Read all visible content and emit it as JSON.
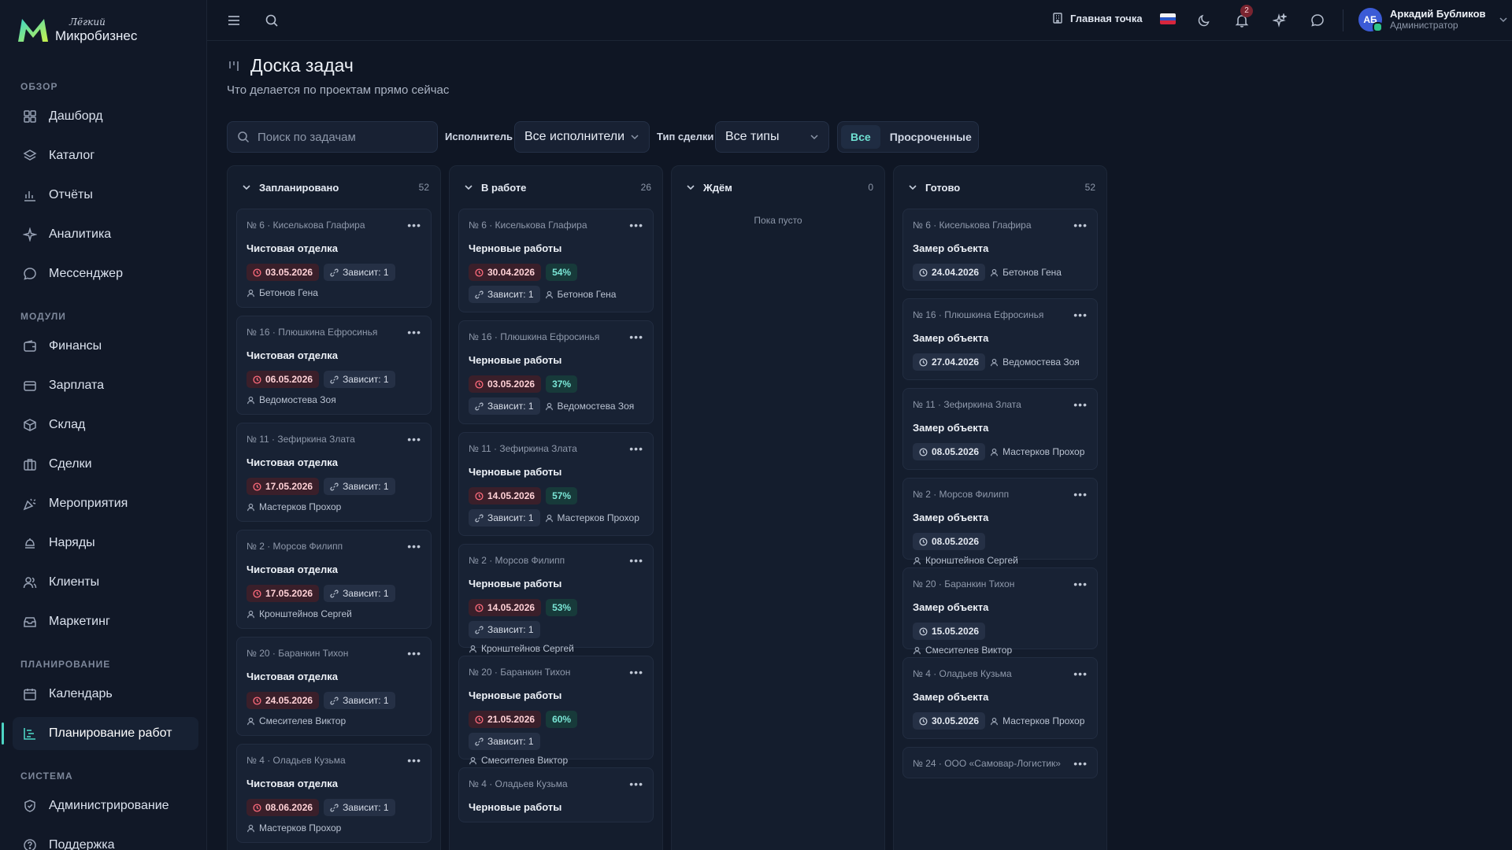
{
  "brand": {
    "small": "Лёгкий",
    "big": "Микробизнес"
  },
  "sidebar": {
    "sections": [
      {
        "label": "ОБЗОР",
        "items": [
          {
            "label": "Дашборд",
            "icon": "dashboard-icon"
          },
          {
            "label": "Каталог",
            "icon": "catalog-icon"
          },
          {
            "label": "Отчёты",
            "icon": "reports-icon"
          },
          {
            "label": "Аналитика",
            "icon": "analytics-icon"
          },
          {
            "label": "Мессенджер",
            "icon": "messenger-icon"
          }
        ]
      },
      {
        "label": "МОДУЛИ",
        "items": [
          {
            "label": "Финансы",
            "icon": "wallet-icon"
          },
          {
            "label": "Зарплата",
            "icon": "salary-icon"
          },
          {
            "label": "Склад",
            "icon": "warehouse-icon"
          },
          {
            "label": "Сделки",
            "icon": "deals-icon"
          },
          {
            "label": "Мероприятия",
            "icon": "party-icon"
          },
          {
            "label": "Наряды",
            "icon": "orders-icon"
          },
          {
            "label": "Клиенты",
            "icon": "clients-icon"
          },
          {
            "label": "Маркетинг",
            "icon": "marketing-icon"
          }
        ]
      },
      {
        "label": "ПЛАНИРОВАНИЕ",
        "items": [
          {
            "label": "Календарь",
            "icon": "calendar-icon"
          },
          {
            "label": "Планирование работ",
            "icon": "planning-icon",
            "active": true
          }
        ]
      },
      {
        "label": "СИСТЕМА",
        "items": [
          {
            "label": "Администрирование",
            "icon": "shield-icon"
          },
          {
            "label": "Поддержка",
            "icon": "help-icon"
          }
        ]
      }
    ]
  },
  "topbar": {
    "point_label": "Главная точка",
    "notifications_count": "2",
    "user": {
      "initials": "АБ",
      "name": "Аркадий Бубликов",
      "role": "Администратор"
    }
  },
  "page": {
    "title": "Доска задач",
    "subtitle": "Что делается по проектам прямо сейчас"
  },
  "filters": {
    "search_placeholder": "Поиск по задачам",
    "executor_label": "Исполнитель",
    "executor_value": "Все исполнители",
    "deal_type_label": "Тип сделки",
    "deal_type_value": "Все типы",
    "toggle": [
      "Все",
      "Просроченные"
    ]
  },
  "colors": {
    "accent": "#4dd4c4",
    "overdue": "#ff6b7c",
    "background": "#0f1624"
  },
  "columns": [
    {
      "title": "Запланировано",
      "count": "52",
      "empty_text": "",
      "cards": [
        {
          "meta": "№ 6 · Киселькова Глафира",
          "title": "Чистовая отделка",
          "date": "03.05.2026",
          "overdue": true,
          "pct": "",
          "dep": "Зависит: 1",
          "person": "Бетонов Гена"
        },
        {
          "meta": "№ 16 · Плюшкина Ефросинья",
          "title": "Чистовая отделка",
          "date": "06.05.2026",
          "overdue": true,
          "pct": "",
          "dep": "Зависит: 1",
          "person": "Ведомостева Зоя"
        },
        {
          "meta": "№ 11 · Зефиркина Злата",
          "title": "Чистовая отделка",
          "date": "17.05.2026",
          "overdue": true,
          "pct": "",
          "dep": "Зависит: 1",
          "person": "Мастерков Прохор"
        },
        {
          "meta": "№ 2 · Морсов Филипп",
          "title": "Чистовая отделка",
          "date": "17.05.2026",
          "overdue": true,
          "pct": "",
          "dep": "Зависит: 1",
          "person": "Кронштейнов Сергей"
        },
        {
          "meta": "№ 20 · Баранкин Тихон",
          "title": "Чистовая отделка",
          "date": "24.05.2026",
          "overdue": true,
          "pct": "",
          "dep": "Зависит: 1",
          "person": "Смесителев Виктор"
        },
        {
          "meta": "№ 4 · Оладьев Кузьма",
          "title": "Чистовая отделка",
          "date": "08.06.2026",
          "overdue": true,
          "pct": "",
          "dep": "Зависит: 1",
          "person": "Мастерков Прохор"
        }
      ]
    },
    {
      "title": "В работе",
      "count": "26",
      "empty_text": "",
      "cards": [
        {
          "meta": "№ 6 · Киселькова Глафира",
          "title": "Черновые работы",
          "date": "30.04.2026",
          "overdue": true,
          "pct": "54%",
          "dep": "Зависит: 1",
          "person": "Бетонов Гена"
        },
        {
          "meta": "№ 16 · Плюшкина Ефросинья",
          "title": "Черновые работы",
          "date": "03.05.2026",
          "overdue": true,
          "pct": "37%",
          "dep": "Зависит: 1",
          "person": "Ведомостева Зоя"
        },
        {
          "meta": "№ 11 · Зефиркина Злата",
          "title": "Черновые работы",
          "date": "14.05.2026",
          "overdue": true,
          "pct": "57%",
          "dep": "Зависит: 1",
          "person": "Мастерков Прохор"
        },
        {
          "meta": "№ 2 · Морсов Филипп",
          "title": "Черновые работы",
          "date": "14.05.2026",
          "overdue": true,
          "pct": "53%",
          "dep": "Зависит: 1",
          "person": "Кронштейнов Сергей"
        },
        {
          "meta": "№ 20 · Баранкин Тихон",
          "title": "Черновые работы",
          "date": "21.05.2026",
          "overdue": true,
          "pct": "60%",
          "dep": "Зависит: 1",
          "person": "Смесителев Виктор"
        },
        {
          "meta": "№ 4 · Оладьев Кузьма",
          "title": "Черновые работы",
          "date": "",
          "overdue": true,
          "pct": "",
          "dep": "",
          "person": ""
        }
      ]
    },
    {
      "title": "Ждём",
      "count": "0",
      "empty_text": "Пока пусто",
      "cards": []
    },
    {
      "title": "Готово",
      "count": "52",
      "empty_text": "",
      "cards": [
        {
          "meta": "№ 6 · Киселькова Глафира",
          "title": "Замер объекта",
          "date": "24.04.2026",
          "overdue": false,
          "pct": "",
          "dep": "",
          "person": "Бетонов Гена"
        },
        {
          "meta": "№ 16 · Плюшкина Ефросинья",
          "title": "Замер объекта",
          "date": "27.04.2026",
          "overdue": false,
          "pct": "",
          "dep": "",
          "person": "Ведомостева Зоя"
        },
        {
          "meta": "№ 11 · Зефиркина Злата",
          "title": "Замер объекта",
          "date": "08.05.2026",
          "overdue": false,
          "pct": "",
          "dep": "",
          "person": "Мастерков Прохор"
        },
        {
          "meta": "№ 2 · Морсов Филипп",
          "title": "Замер объекта",
          "date": "08.05.2026",
          "overdue": false,
          "pct": "",
          "dep": "",
          "person": "Кронштейнов Сергей"
        },
        {
          "meta": "№ 20 · Баранкин Тихон",
          "title": "Замер объекта",
          "date": "15.05.2026",
          "overdue": false,
          "pct": "",
          "dep": "",
          "person": "Смесителев Виктор"
        },
        {
          "meta": "№ 4 · Оладьев Кузьма",
          "title": "Замер объекта",
          "date": "30.05.2026",
          "overdue": false,
          "pct": "",
          "dep": "",
          "person": "Мастерков Прохор"
        },
        {
          "meta": "№ 24 · ООО «Самовар-Логистик»",
          "title": "",
          "date": "",
          "overdue": false,
          "pct": "",
          "dep": "",
          "person": ""
        }
      ]
    }
  ]
}
